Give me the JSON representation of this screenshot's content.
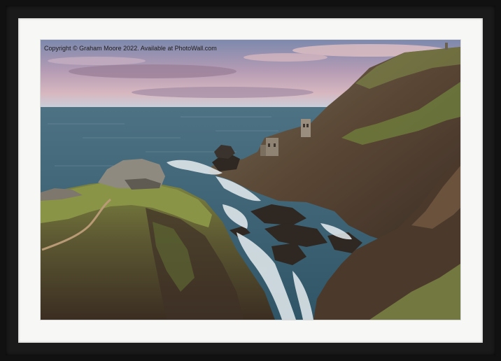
{
  "photo": {
    "copyright_text": "Copyright © Graham Moore 2022. Available at PhotoWall.com"
  },
  "colors": {
    "frame": "#111111",
    "mount": "#f7f7f5",
    "sky_top": "#8a93b3",
    "sky_mid": "#c9a6b4",
    "sea": "#3f6779",
    "cliff_green": "#6f7d3e",
    "rock": "#4a3b2f",
    "foam": "#e8eef0"
  },
  "icons": [
    "mine-engine-house",
    "cliff-path"
  ]
}
